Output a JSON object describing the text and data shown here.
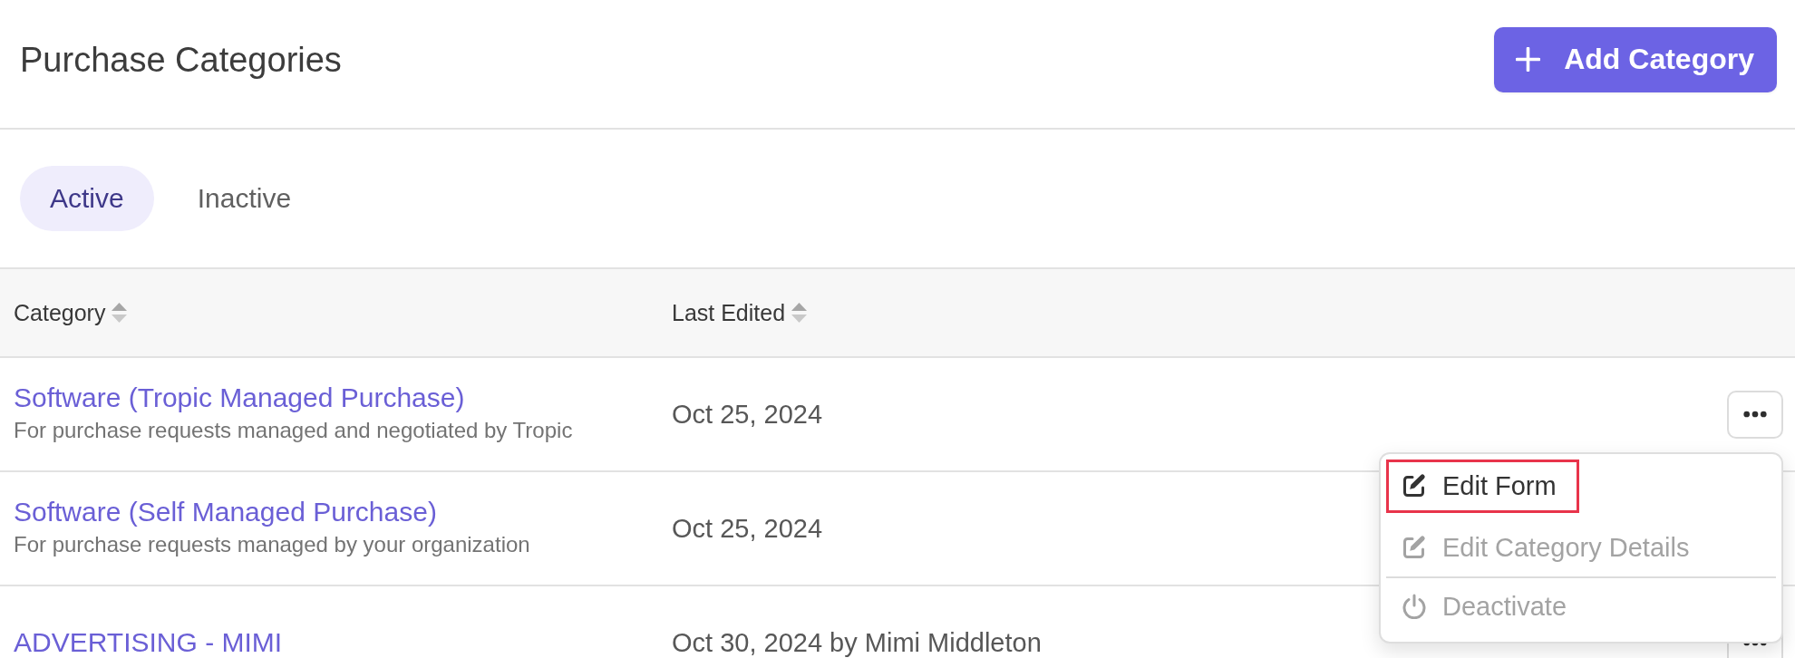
{
  "header": {
    "title": "Purchase Categories",
    "add_button": {
      "label": "Add Category"
    }
  },
  "tabs": [
    {
      "label": "Active",
      "selected": true
    },
    {
      "label": "Inactive",
      "selected": false
    }
  ],
  "table": {
    "columns": [
      {
        "label": "Category",
        "sortable": true
      },
      {
        "label": "Last Edited",
        "sortable": true
      }
    ],
    "rows": [
      {
        "name": "Software (Tropic Managed Purchase)",
        "description": "For purchase requests managed and negotiated by Tropic",
        "last_edited": "Oct 25, 2024",
        "menu": {
          "items": [
            {
              "kind": "edit",
              "label": "Edit Form",
              "disabled": false,
              "highlighted": true,
              "divider_before": false
            },
            {
              "kind": "edit",
              "label": "Edit Category Details",
              "disabled": true,
              "highlighted": false,
              "divider_before": false
            },
            {
              "kind": "power",
              "label": "Deactivate",
              "disabled": true,
              "highlighted": false,
              "divider_before": true
            }
          ]
        }
      },
      {
        "name": "Software (Self Managed Purchase)",
        "description": "For purchase requests managed by your organization",
        "last_edited": "Oct 25, 2024"
      },
      {
        "name": "ADVERTISING - MIMI",
        "last_edited": "Oct 30, 2024 by Mimi Middleton"
      }
    ]
  }
}
